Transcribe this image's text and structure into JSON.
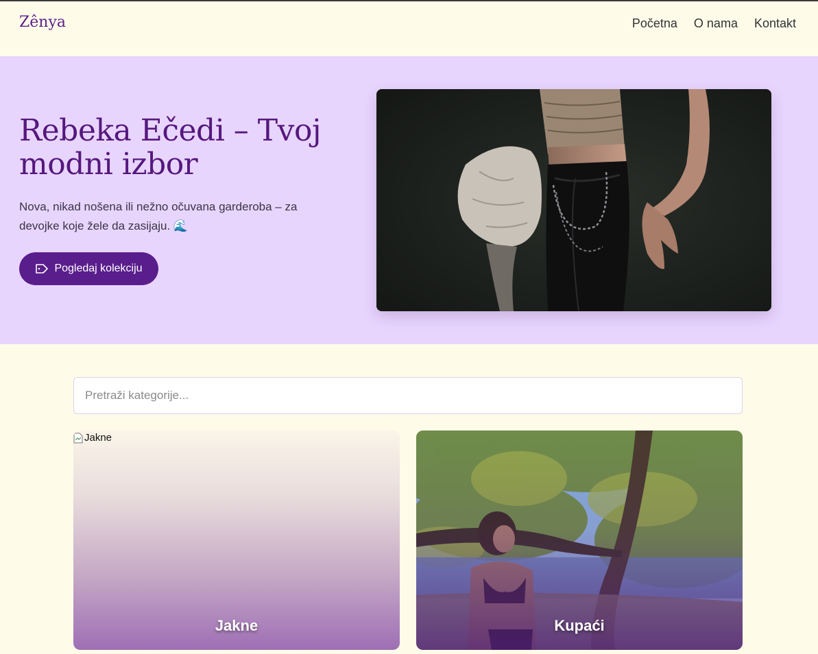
{
  "header": {
    "logo": "Zênya",
    "nav": [
      "Početna",
      "O nama",
      "Kontakt"
    ]
  },
  "hero": {
    "title": "Rebeka Ečedi – Tvoj modni izbor",
    "subtitle": "Nova, nikad nošena ili nežno očuvana garderoba – za devojke koje žele da zasijaju. 🌊",
    "button_label": "Pogledaj kolekciju",
    "button_icon": "tag-icon",
    "image_alt": "Model in black leather pants and beige top"
  },
  "search": {
    "placeholder": "Pretraži kategorije...",
    "value": ""
  },
  "categories": [
    {
      "label": "Jakne",
      "image_alt": "Jakne",
      "image_broken": true
    },
    {
      "label": "Kupaći",
      "image_alt": "Kupaći",
      "image_broken": false
    }
  ],
  "colors": {
    "brand": "#5a1e8c",
    "hero_bg": "#e8d5fd",
    "page_bg": "#fefbe9"
  }
}
